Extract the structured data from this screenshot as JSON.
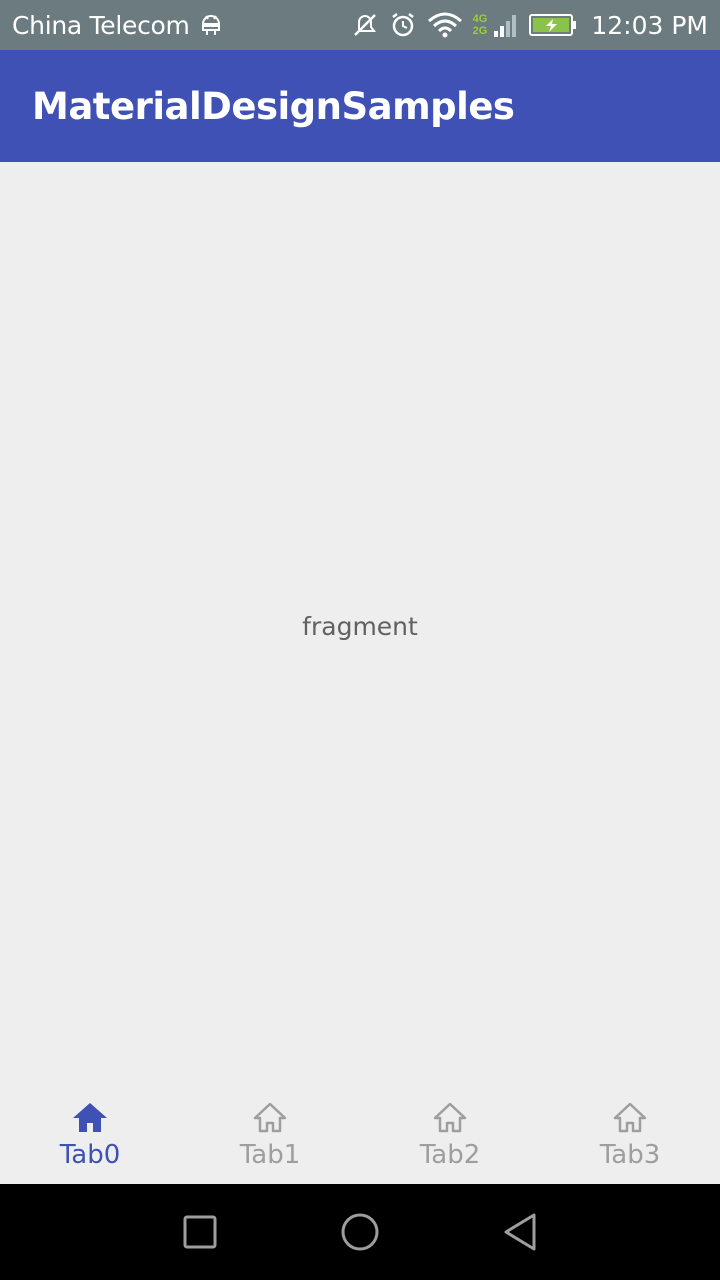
{
  "status_bar": {
    "carrier": "China Telecom",
    "net_top": "4G",
    "net_bottom": "2G",
    "time": "12:03 PM",
    "icons": [
      "android-debug-icon",
      "mute-icon",
      "alarm-icon",
      "wifi-icon",
      "signal-icon",
      "battery-charging-icon"
    ]
  },
  "app_bar": {
    "title": "MaterialDesignSamples"
  },
  "content": {
    "text": "fragment"
  },
  "bottom_nav": {
    "active_color": "#3f51b5",
    "inactive_color": "#9e9e9e",
    "tabs": [
      {
        "label": "Tab0",
        "icon": "home-filled-icon",
        "active": true
      },
      {
        "label": "Tab1",
        "icon": "home-outline-icon",
        "active": false
      },
      {
        "label": "Tab2",
        "icon": "home-outline-icon",
        "active": false
      },
      {
        "label": "Tab3",
        "icon": "home-outline-icon",
        "active": false
      }
    ]
  },
  "system_nav": {
    "buttons": [
      "recents-icon",
      "home-icon",
      "back-icon"
    ]
  },
  "colors": {
    "primary": "#3f51b5",
    "status_bar": "#6b7b80",
    "background": "#eeeeee"
  }
}
